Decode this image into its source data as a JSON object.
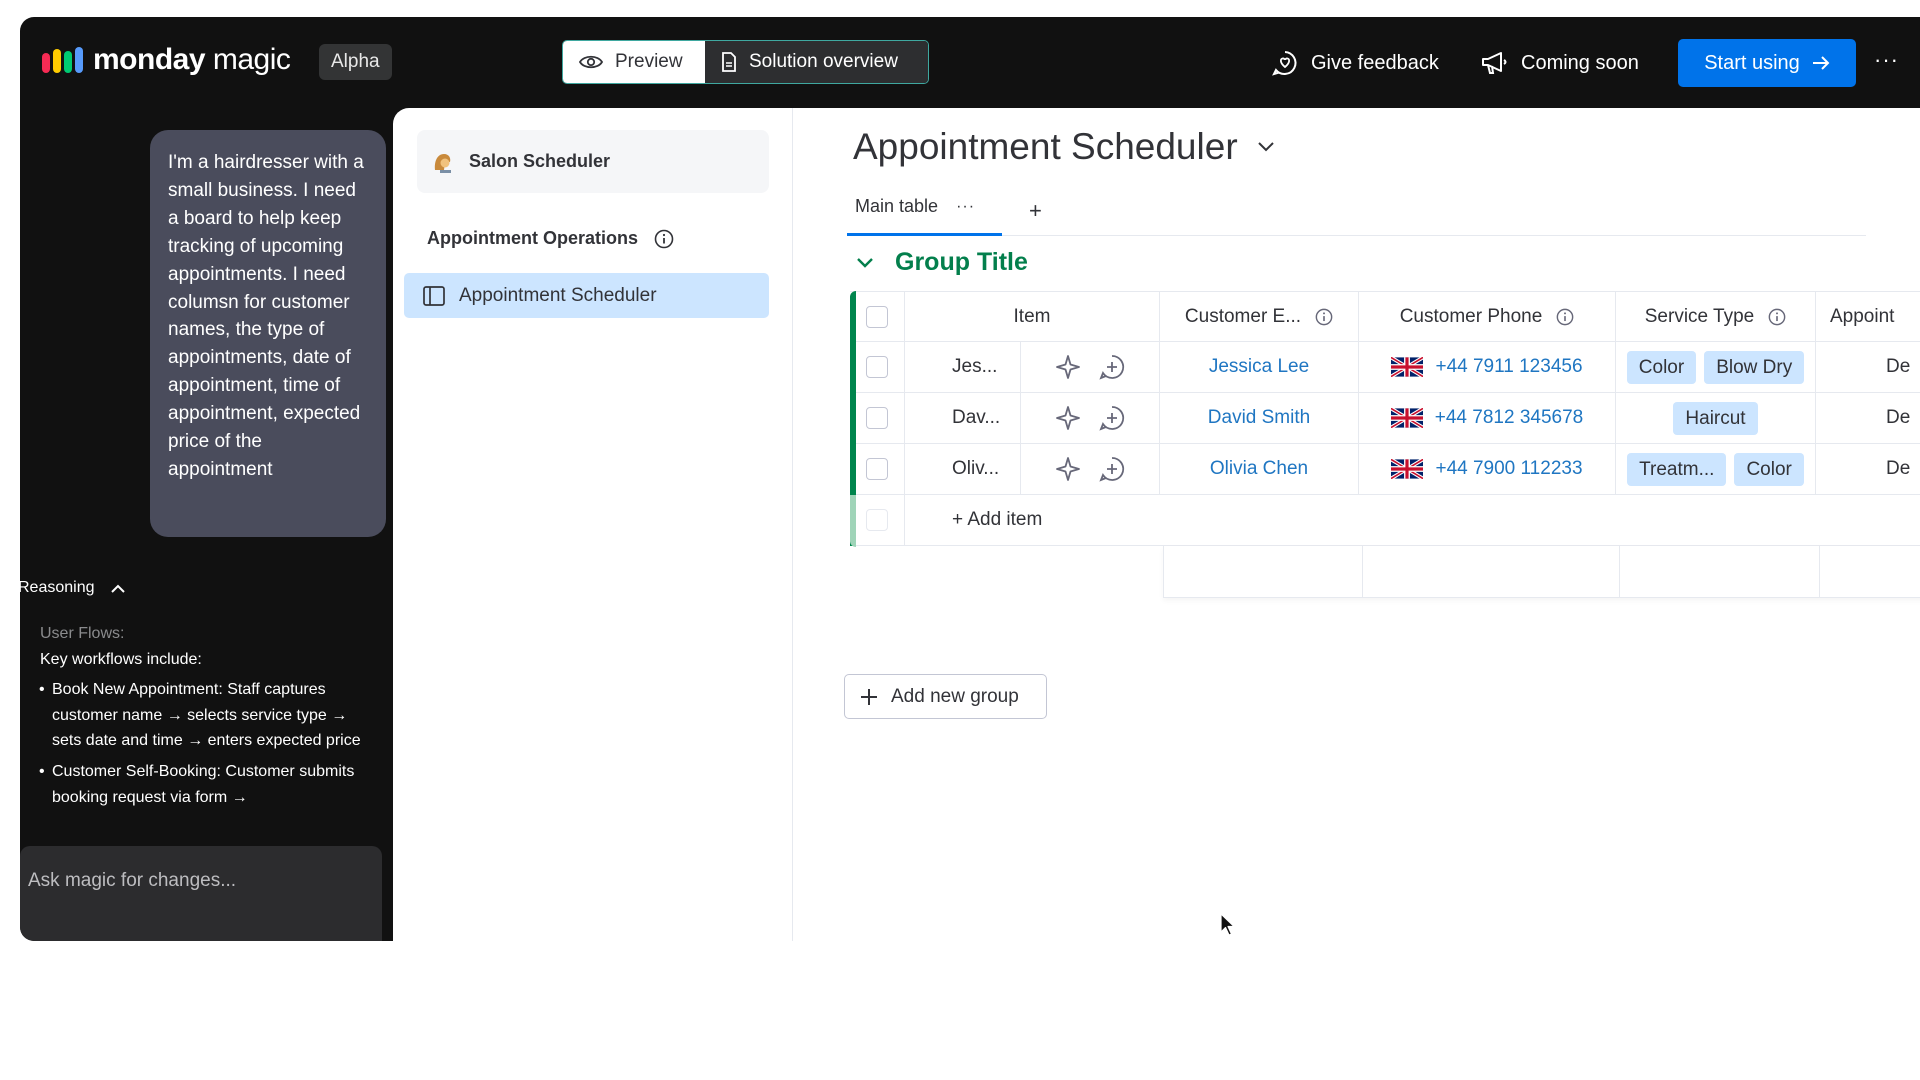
{
  "header": {
    "logo_bold": "monday",
    "logo_light": "magic",
    "logo_colors": [
      "#f62b54",
      "#ffcc00",
      "#00ca72",
      "#579bfc"
    ],
    "badge": "Alpha",
    "preview_label": "Preview",
    "overview_label": "Solution overview",
    "feedback_label": "Give feedback",
    "coming_soon_label": "Coming soon",
    "start_label": "Start using",
    "more_label": "···"
  },
  "chat": {
    "message": "I'm a hairdresser with a small business. I need a board to help keep tracking of upcoming appointments. I need columsn for customer names, the type of appointments, date of appointment, time of appointment, expected price of the appointment",
    "reasoning_label": "Reasoning",
    "reasoning_heading": "User Flows:",
    "reasoning_intro": "Key workflows include:",
    "reasoning_items": [
      "Book New Appointment: Staff captures customer name → selects service type → sets date and time → enters expected price",
      "Customer Self-Booking: Customer submits booking request via form →"
    ],
    "ask_placeholder": "Ask magic for changes..."
  },
  "nav": {
    "workspace_name": "Salon Scheduler",
    "group_name": "Appointment Operations",
    "board_item": "Appointment Scheduler"
  },
  "board": {
    "title": "Appointment Scheduler",
    "tab_main": "Main table",
    "tab_more": "···",
    "tab_add": "+",
    "group_title": "Group Title",
    "group_color": "#037f4c",
    "columns": {
      "item": "Item",
      "email": "Customer E...",
      "phone": "Customer Phone",
      "service": "Service Type",
      "appoint": "Appoint"
    },
    "rows": [
      {
        "item": "Jes...",
        "email": "Jessica Lee",
        "phone": "+44 7911 123456",
        "tags": [
          "Color",
          "Blow Dry"
        ],
        "appoint": "De"
      },
      {
        "item": "Dav...",
        "email": "David Smith",
        "phone": "+44 7812 345678",
        "tags": [
          "Haircut"
        ],
        "appoint": "De"
      },
      {
        "item": "Oliv...",
        "email": "Olivia Chen",
        "phone": "+44 7900 112233",
        "tags": [
          "Treatm...",
          "Color"
        ],
        "appoint": "De"
      }
    ],
    "add_item": "+ Add item",
    "add_group": "Add new group"
  }
}
